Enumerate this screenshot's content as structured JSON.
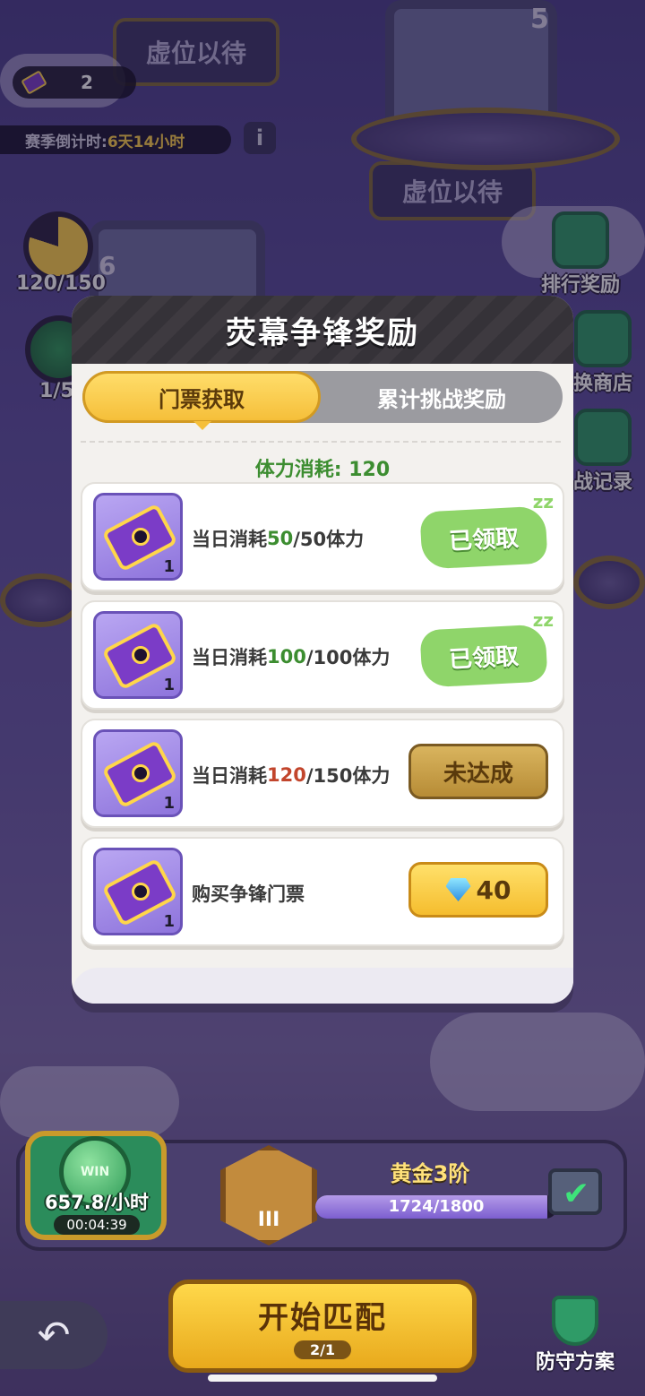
{
  "background": {
    "plate_left": "虚位以待",
    "plate_right": "虚位以待",
    "slot_number_top": "5",
    "slot_number_left": "6",
    "ticket_count": "2",
    "countdown_label": "赛季倒计时:",
    "countdown_value": "6天14小时",
    "info_icon": "i",
    "progress_left": "120/150",
    "win_partial": "1/5",
    "side_buttons": [
      {
        "label": "排行奖励",
        "icon": "gift-icon"
      },
      {
        "label": "换商店",
        "icon": "shop-icon"
      },
      {
        "label": "战记录",
        "icon": "record-icon"
      }
    ]
  },
  "modal": {
    "title": "荧幕争锋奖励",
    "tabs": [
      {
        "label": "门票获取",
        "active": true
      },
      {
        "label": "累计挑战奖励",
        "active": false
      }
    ],
    "stamina_label": "体力消耗: 120",
    "rows": [
      {
        "prefix": "当日消耗",
        "current": "50",
        "suffix": "/50体力",
        "current_color": "green",
        "qty": "1",
        "status": "claimed",
        "action": "已领取"
      },
      {
        "prefix": "当日消耗",
        "current": "100",
        "suffix": "/100体力",
        "current_color": "green",
        "qty": "1",
        "status": "claimed",
        "action": "已领取"
      },
      {
        "prefix": "当日消耗",
        "current": "120",
        "suffix": "/150体力",
        "current_color": "red",
        "qty": "1",
        "status": "not_reached",
        "action": "未达成"
      },
      {
        "prefix": "购买争锋门票",
        "current": "",
        "suffix": "",
        "current_color": "none",
        "qty": "1",
        "status": "buy",
        "action": "40"
      }
    ]
  },
  "bottom": {
    "win_coin_text": "WIN",
    "win_rate": "657.8/小时",
    "win_timer": "00:04:39",
    "rank_roman": "III",
    "rank_name": "黄金3阶",
    "rank_progress_text": "1724/1800",
    "rank_progress": 0.958,
    "start_label": "开始匹配",
    "start_ticket_count": "2/1",
    "defense_label": "防守方案"
  },
  "colors": {
    "accent_yellow": "#f5bf3a",
    "green_text": "#3c8d30",
    "red_text": "#c2452c",
    "claimed_green": "#8fd56a"
  }
}
